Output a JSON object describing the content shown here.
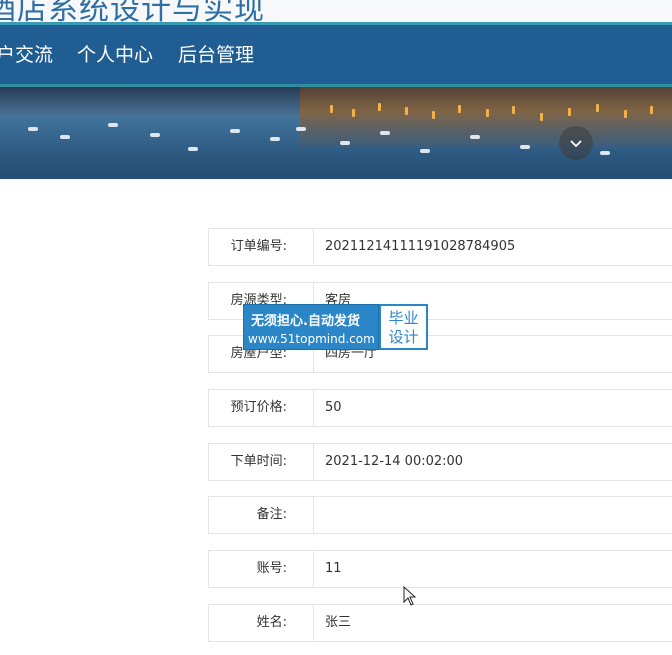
{
  "header": {
    "site_title": "酒店系统设计与实现"
  },
  "nav": {
    "items": [
      {
        "label": "户交流"
      },
      {
        "label": "个人中心"
      },
      {
        "label": "后台管理"
      }
    ]
  },
  "banner": {
    "scroll_icon": "chevron-down-icon"
  },
  "detail": {
    "rows": [
      {
        "label": "订单编号:",
        "value": "20211214111191028784905"
      },
      {
        "label": "房源类型:",
        "value": "客房"
      },
      {
        "label": "房屋户型:",
        "value": "四房一厅"
      },
      {
        "label": "预订价格:",
        "value": "50"
      },
      {
        "label": "下单时间:",
        "value": "2021-12-14 00:02:00"
      },
      {
        "label": "备注:",
        "value": ""
      },
      {
        "label": "账号:",
        "value": "11"
      },
      {
        "label": "姓名:",
        "value": "张三"
      }
    ]
  },
  "watermark": {
    "line1": "无须担心.自动发货",
    "line2": "www.51topmind.com",
    "right_line1": "毕业",
    "right_line2": "设计"
  },
  "colors": {
    "nav_bg": "#1f5d93",
    "accent": "#2b86c8"
  }
}
